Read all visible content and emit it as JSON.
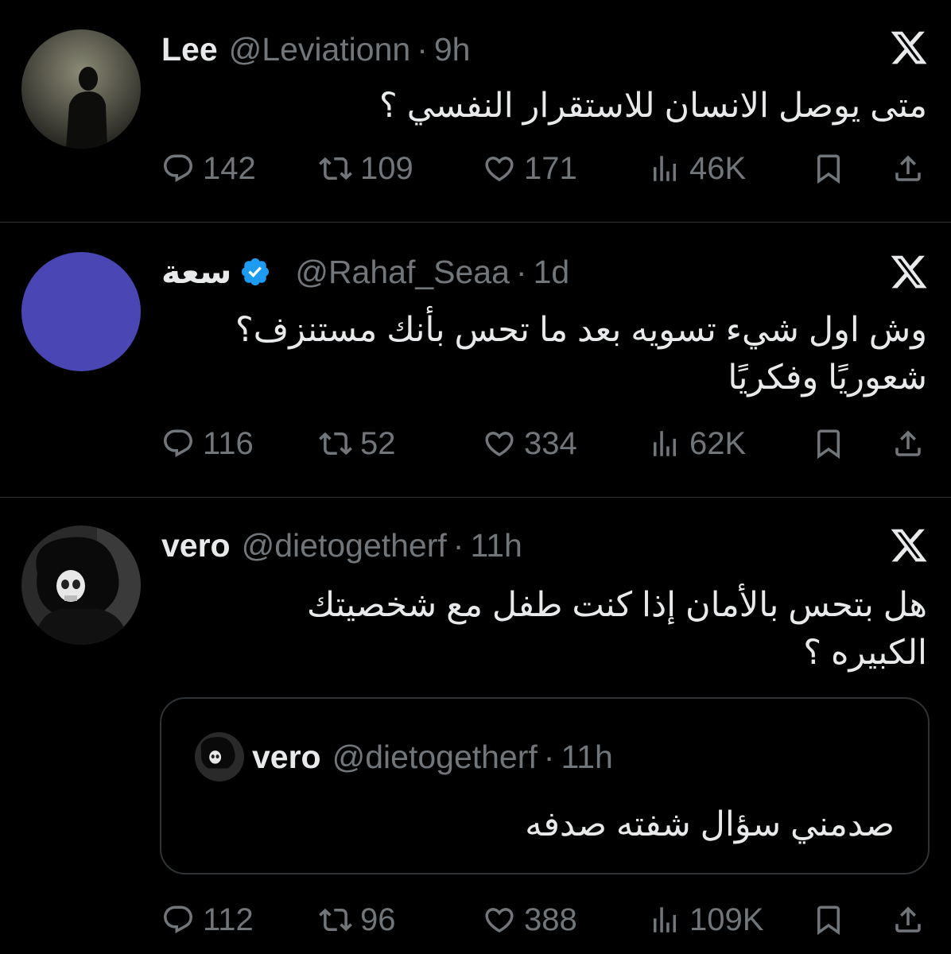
{
  "tweets": [
    {
      "name": "Lee",
      "handle": "@Leviationn",
      "dot": "·",
      "time": "9h",
      "text_lines": [
        "متى يوصل الانسان للاستقرار النفسي ؟"
      ],
      "replies": "142",
      "retweets": "109",
      "likes": "171",
      "views": "46K"
    },
    {
      "name": "سعة",
      "handle": "@Rahaf_Seaa",
      "dot": "·",
      "time": "1d",
      "verified": true,
      "avatar_color": "#4a46b3",
      "text_lines": [
        "وش اول شيء تسويه بعد ما تحس بأنك مستنزف؟",
        "شعوريًا وفكريًا"
      ],
      "replies": "116",
      "retweets": "52",
      "likes": "334",
      "views": "62K"
    },
    {
      "name": "vero",
      "handle": "@dietogetherf",
      "dot": "·",
      "time": "11h",
      "text_lines": [
        "هل بتحس بالأمان إذا كنت طفل مع شخصيتك",
        "الكبيره ؟"
      ],
      "quote": {
        "name": "vero",
        "handle": "@dietogetherf",
        "dot": "·",
        "time": "11h",
        "text": "صدمني سؤال شفته صدفه"
      },
      "replies": "112",
      "retweets": "96",
      "likes": "388",
      "views": "109K"
    }
  ],
  "colors": {
    "background": "#000000",
    "text": "#e7e9ea",
    "secondary": "#71767b",
    "verified": "#1d9bf0",
    "separator": "#2f3336"
  },
  "icons": [
    "reply-icon",
    "retweet-icon",
    "like-icon",
    "views-icon",
    "bookmark-icon",
    "share-icon",
    "x-logo-icon",
    "verified-badge-icon"
  ]
}
